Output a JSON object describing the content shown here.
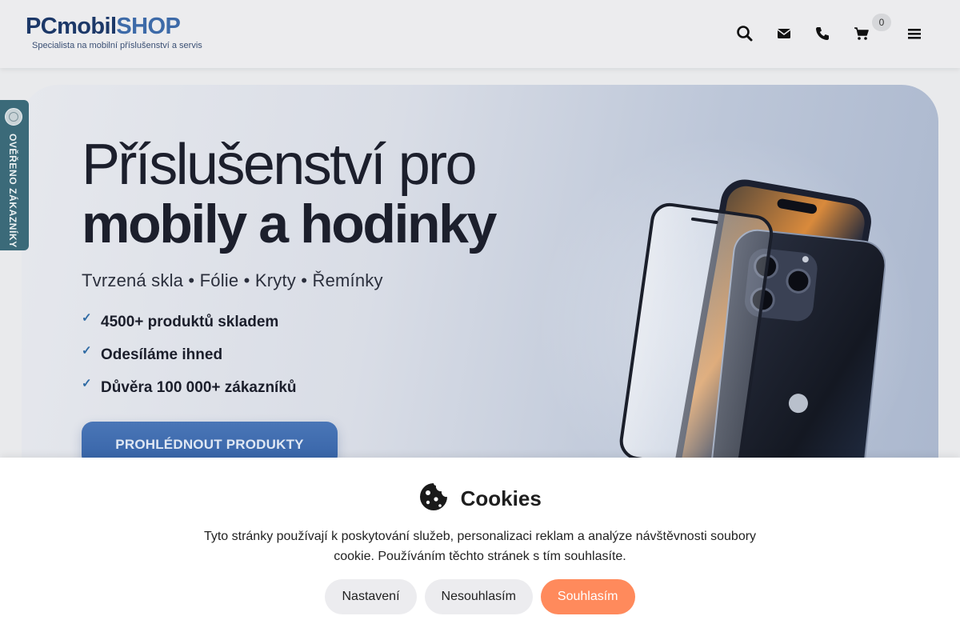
{
  "header": {
    "logo_primary": "PCmobil",
    "logo_accent": "SHOP",
    "logo_tagline": "Specialista na mobilní příslušenství a servis",
    "icons": [
      "search-icon",
      "envelope-icon",
      "phone-icon",
      "cart-icon",
      "menu-icon"
    ],
    "cart_count": "0"
  },
  "side_widget": {
    "label": "OVĚŘENO ZÁKAZNÍKY"
  },
  "hero": {
    "title_line1": "Příslušenství pro",
    "title_line2": "mobily a hodinky",
    "subtitle": "Tvrzená skla • Fólie • Kryty • Řemínky",
    "features": [
      {
        "text": "4500+ produktů skladem"
      },
      {
        "text": "Odesíláme ihned"
      },
      {
        "text": "Důvěra 100 000+ zákazníků"
      }
    ],
    "cta_label": "PROHLÉDNOUT PRODUKTY"
  },
  "cookie": {
    "title": "Cookies",
    "text": "Tyto stránky používají k poskytování služeb, personalizaci reklam a analýze návštěvnosti soubory cookie. Používáním těchto stránek s tím souhlasíte.",
    "btn_settings": "Nastavení",
    "btn_reject": "Nesouhlasím",
    "btn_accept": "Souhlasím"
  },
  "colors": {
    "brand_dark": "#1c3868",
    "brand_light": "#3d6aa8",
    "cta": "#3562a6",
    "accept": "#ff8a5c",
    "verified_badge": "#3b6a79"
  }
}
